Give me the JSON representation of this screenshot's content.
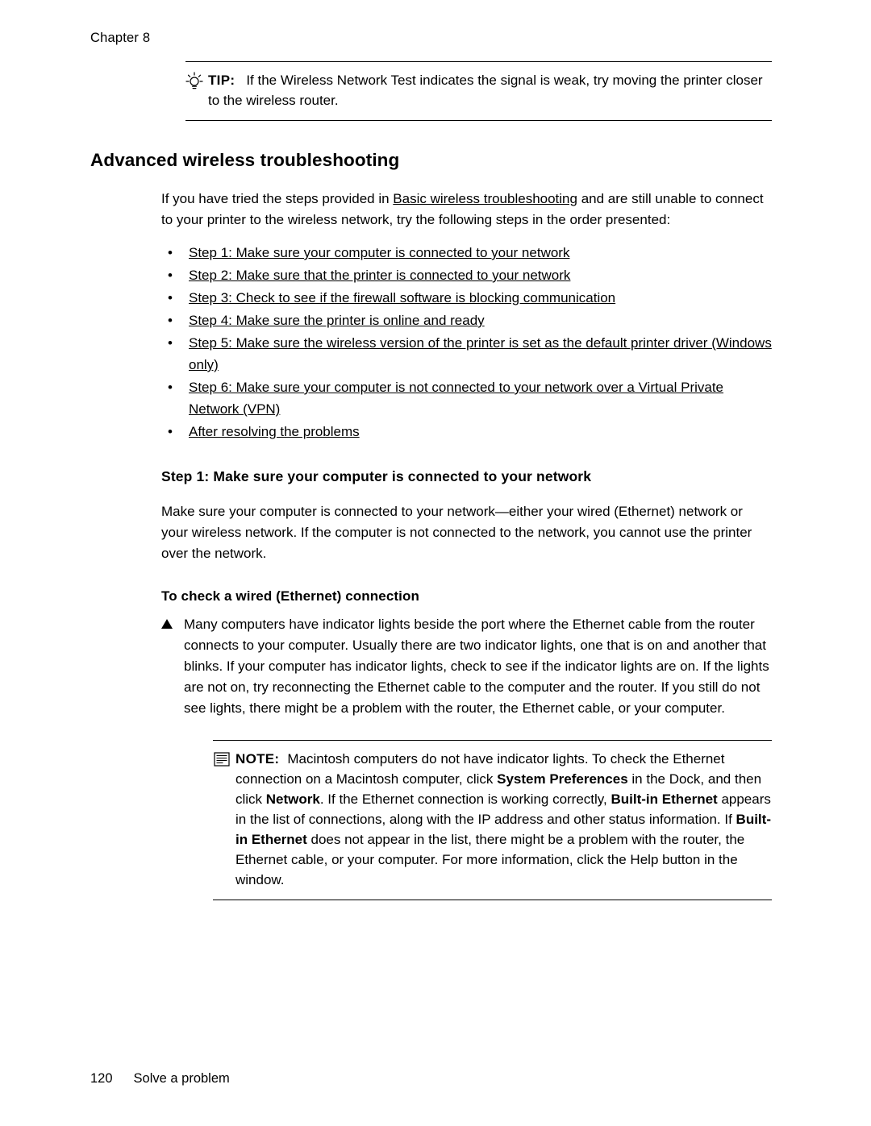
{
  "header": {
    "chapter": "Chapter 8"
  },
  "tip": {
    "icon": "lightbulb-icon",
    "label": "TIP:",
    "text": "If the Wireless Network Test indicates the signal is weak, try moving the printer closer to the wireless router."
  },
  "section": {
    "title": "Advanced wireless troubleshooting",
    "intro_part1": "If you have tried the steps provided in ",
    "intro_link": "Basic wireless troubleshooting",
    "intro_part2": " and are still unable to connect to your printer to the wireless network, try the following steps in the order presented:",
    "steps": [
      "Step 1: Make sure your computer is connected to your network",
      "Step 2: Make sure that the printer is connected to your network",
      "Step 3: Check to see if the firewall software is blocking communication",
      "Step 4: Make sure the printer is online and ready",
      "Step 5: Make sure the wireless version of the printer is set as the default printer driver (Windows only)",
      "Step 6: Make sure your computer is not connected to your network over a Virtual Private Network (VPN)",
      "After resolving the problems"
    ]
  },
  "step1": {
    "heading": "Step 1: Make sure your computer is connected to your network",
    "paragraph": "Make sure your computer is connected to your network—either your wired (Ethernet) network or your wireless network. If the computer is not connected to the network, you cannot use the printer over the network.",
    "subheading": "To check a wired (Ethernet) connection",
    "bullet_icon": "triangle-bullet-icon",
    "bullet_text": "Many computers have indicator lights beside the port where the Ethernet cable from the router connects to your computer. Usually there are two indicator lights, one that is on and another that blinks. If your computer has indicator lights, check to see if the indicator lights are on. If the lights are not on, try reconnecting the Ethernet cable to the computer and the router. If you still do not see lights, there might be a problem with the router, the Ethernet cable, or your computer."
  },
  "note": {
    "icon": "note-icon",
    "label": "NOTE:",
    "t1": "Macintosh computers do not have indicator lights. To check the Ethernet connection on a Macintosh computer, click ",
    "b1": "System Preferences",
    "t2": " in the Dock, and then click ",
    "b2": "Network",
    "t3": ". If the Ethernet connection is working correctly, ",
    "b3": "Built-in Ethernet",
    "t4": " appears in the list of connections, along with the IP address and other status information. If ",
    "b4": "Built-in Ethernet",
    "t5": " does not appear in the list, there might be a problem with the router, the Ethernet cable, or your computer. For more information, click the Help button in the window."
  },
  "footer": {
    "page_number": "120",
    "section_name": "Solve a problem"
  }
}
